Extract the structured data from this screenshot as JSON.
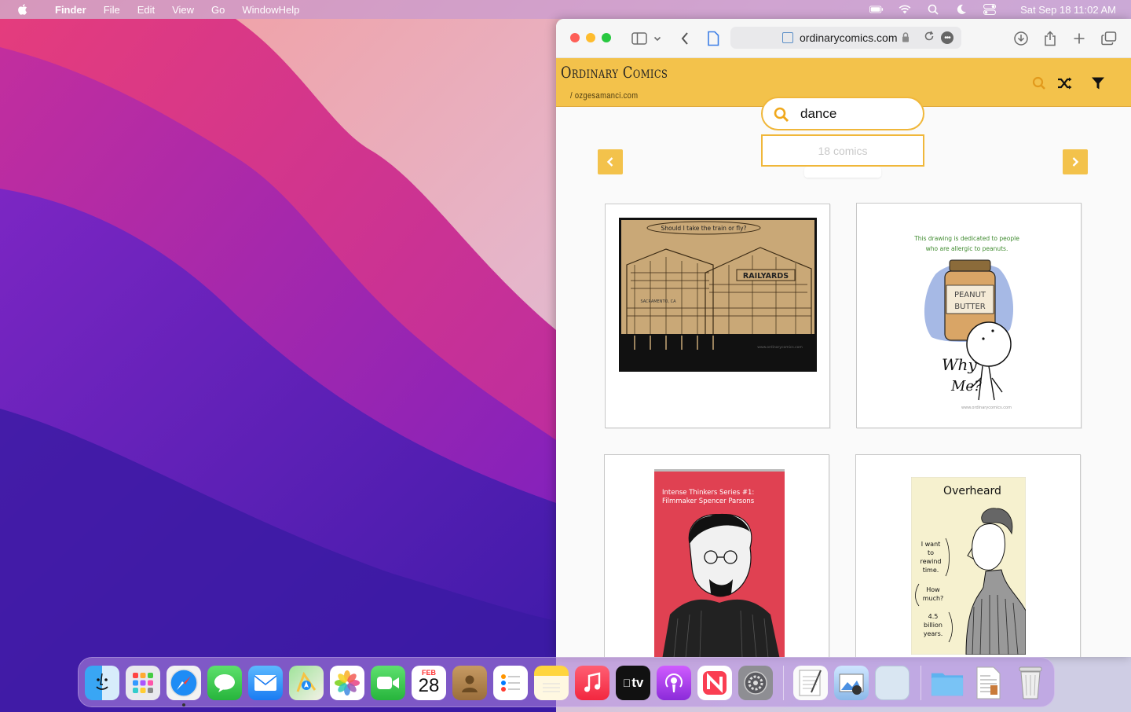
{
  "menubar": {
    "app_name": "Finder",
    "menus": [
      "File",
      "Edit",
      "View",
      "Go",
      "Window",
      "Help"
    ],
    "clock": "Sat Sep 18  11:02 AM"
  },
  "browser": {
    "url": "ordinarycomics.com"
  },
  "site": {
    "title": "Ordinary Comics",
    "subtitle": "/ ozgesamanci.com",
    "accent_color": "#f3c24b"
  },
  "search": {
    "query": "dance",
    "results_text": "18 comics"
  },
  "comics": [
    {
      "speech": "Should I take the train or fly?",
      "sign": "RAILYARDS",
      "small_sign": "SACRAMENTO, CA",
      "credit": "www.ordinarycomics.com"
    },
    {
      "caption_line1": "This drawing is dedicated to people",
      "caption_line2": "who are allergic to peanuts.",
      "jar_line1": "PEANUT",
      "jar_line2": "BUTTER",
      "exclaim_line1": "Why",
      "exclaim_line2": "Me?",
      "credit": "www.ordinarycomics.com"
    },
    {
      "caption_line1": "Intense Thinkers Series #1:",
      "caption_line2": "Filmmaker Spencer Parsons"
    },
    {
      "title": "Overheard",
      "bubble1_lines": [
        "I want",
        "to",
        "rewind",
        "time."
      ],
      "bubble2_lines": [
        "How",
        "much?"
      ],
      "bubble3_lines": [
        "4.5",
        "billion",
        "years."
      ]
    }
  ],
  "dock": {
    "calendar_month": "FEB",
    "calendar_day": "28",
    "tv_label": "tv",
    "apps": [
      "finder-icon",
      "launchpad-icon",
      "safari-icon",
      "messages-icon",
      "mail-icon",
      "maps-icon",
      "photos-icon",
      "facetime-icon",
      "calendar-icon",
      "contacts-icon",
      "reminders-icon",
      "notes-icon",
      "music-icon",
      "tv-icon",
      "podcasts-icon",
      "news-icon",
      "system-preferences-icon",
      "textedit-icon",
      "preview-icon",
      "blank-app-icon",
      "folder-icon",
      "document-icon",
      "trash-icon"
    ]
  }
}
